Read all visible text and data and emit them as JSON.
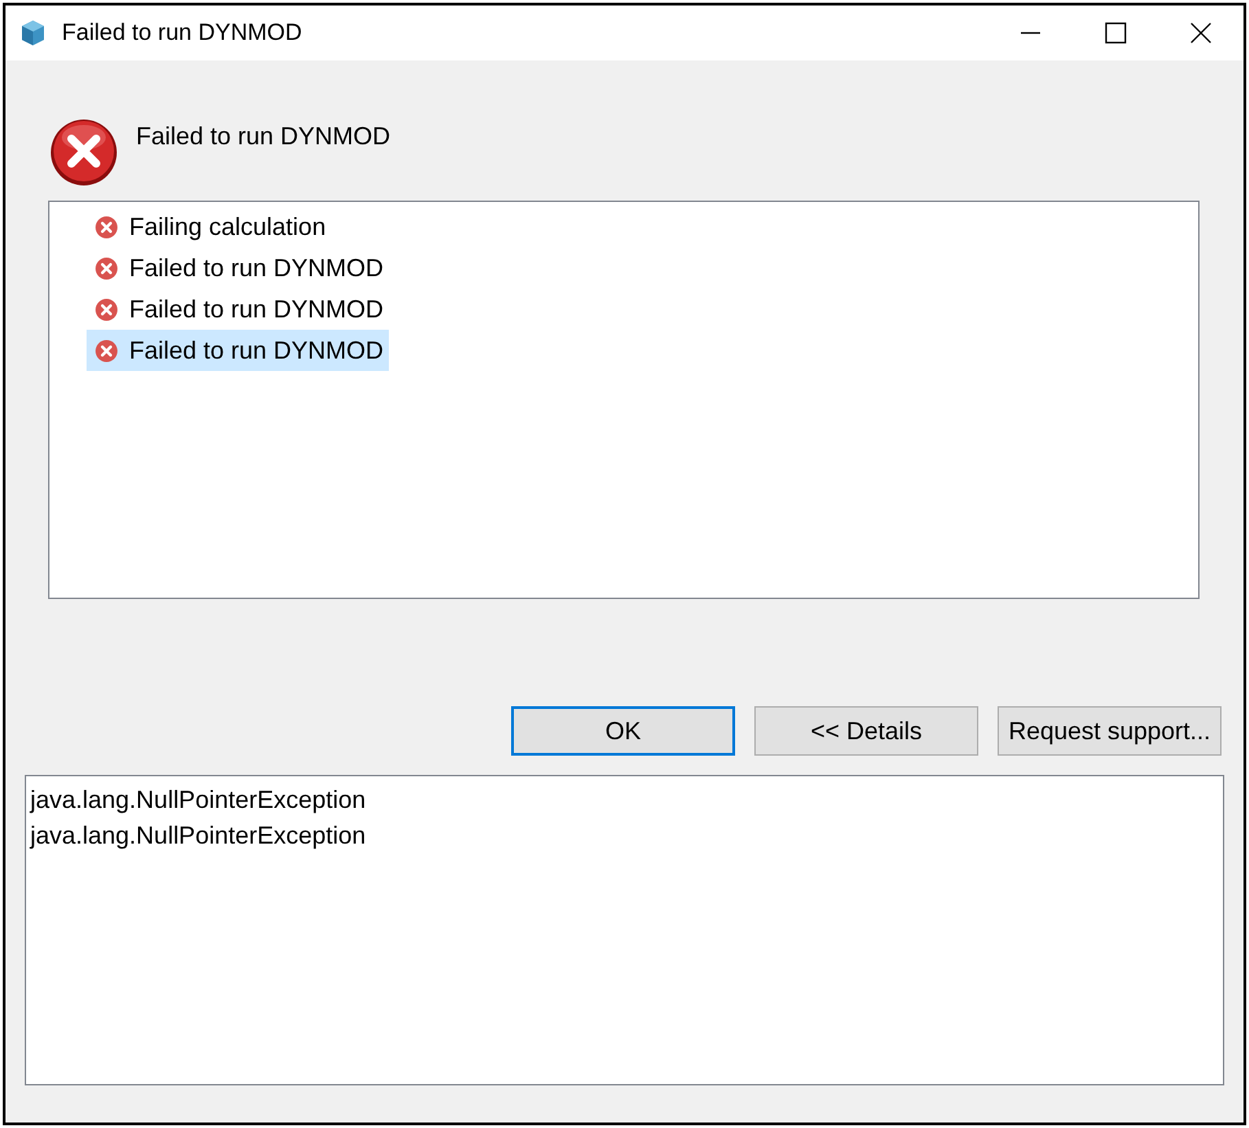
{
  "window": {
    "title": "Failed to run DYNMOD"
  },
  "message": "Failed to run DYNMOD",
  "problems": [
    {
      "label": "Failing calculation",
      "selected": false
    },
    {
      "label": "Failed to run DYNMOD",
      "selected": false
    },
    {
      "label": "Failed to run DYNMOD",
      "selected": false
    },
    {
      "label": "Failed to run DYNMOD",
      "selected": true
    }
  ],
  "buttons": [
    {
      "label": "OK",
      "default": true
    },
    {
      "label": "<< Details",
      "default": false
    },
    {
      "label": "Request support...",
      "default": false
    }
  ],
  "details": [
    "java.lang.NullPointerException",
    "java.lang.NullPointerException"
  ]
}
